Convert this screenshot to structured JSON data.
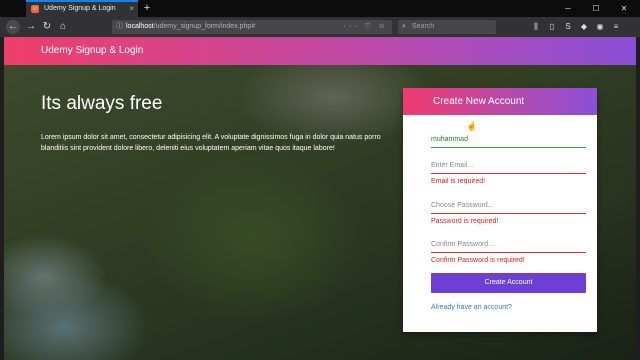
{
  "browser": {
    "tab_title": "Udemy Signup & Login",
    "favicon_text": "U",
    "tab_close": "×",
    "new_tab": "+",
    "url_host": "localhost",
    "url_path": "/udemy_signup_form/index.php#",
    "url_actions": "··· ♡ ☆",
    "search_placeholder": "Search",
    "win_min": "─",
    "win_max": "☐",
    "win_close": "✕"
  },
  "app": {
    "title": "Udemy Signup & Login"
  },
  "hero": {
    "heading": "Its always free",
    "text": "Lorem ipsum dolor sit amet, consectetur adipisicing elit. A voluptate dignissimos fuga in dolor quia natus porro blanditiis sint provident dolore libero, deleniti eius voluptatem aperiam vitae quos itaque labore!"
  },
  "form": {
    "title": "Create New Account",
    "username_value": "muhammad",
    "email_placeholder": "Enter Email...",
    "email_error": "Email is required!",
    "password_placeholder": "Choose Password...",
    "password_error": "Password is required!",
    "confirm_placeholder": "Confirm Password...",
    "confirm_error": "Confirm Password is required!",
    "submit_label": "Create Account",
    "login_link": "Already have an account?"
  },
  "colors": {
    "gradient_start": "#ee3f6b",
    "gradient_end": "#8a4fd6",
    "button": "#6f3fd3",
    "error": "#e02020",
    "valid": "#3aa049",
    "link": "#2f7fd9"
  },
  "icons": [
    "back-icon",
    "forward-icon",
    "reload-icon",
    "home-icon",
    "info-icon",
    "search-icon",
    "library-icon",
    "sidebar-icon",
    "menu-icon",
    "hand-cursor-icon"
  ]
}
